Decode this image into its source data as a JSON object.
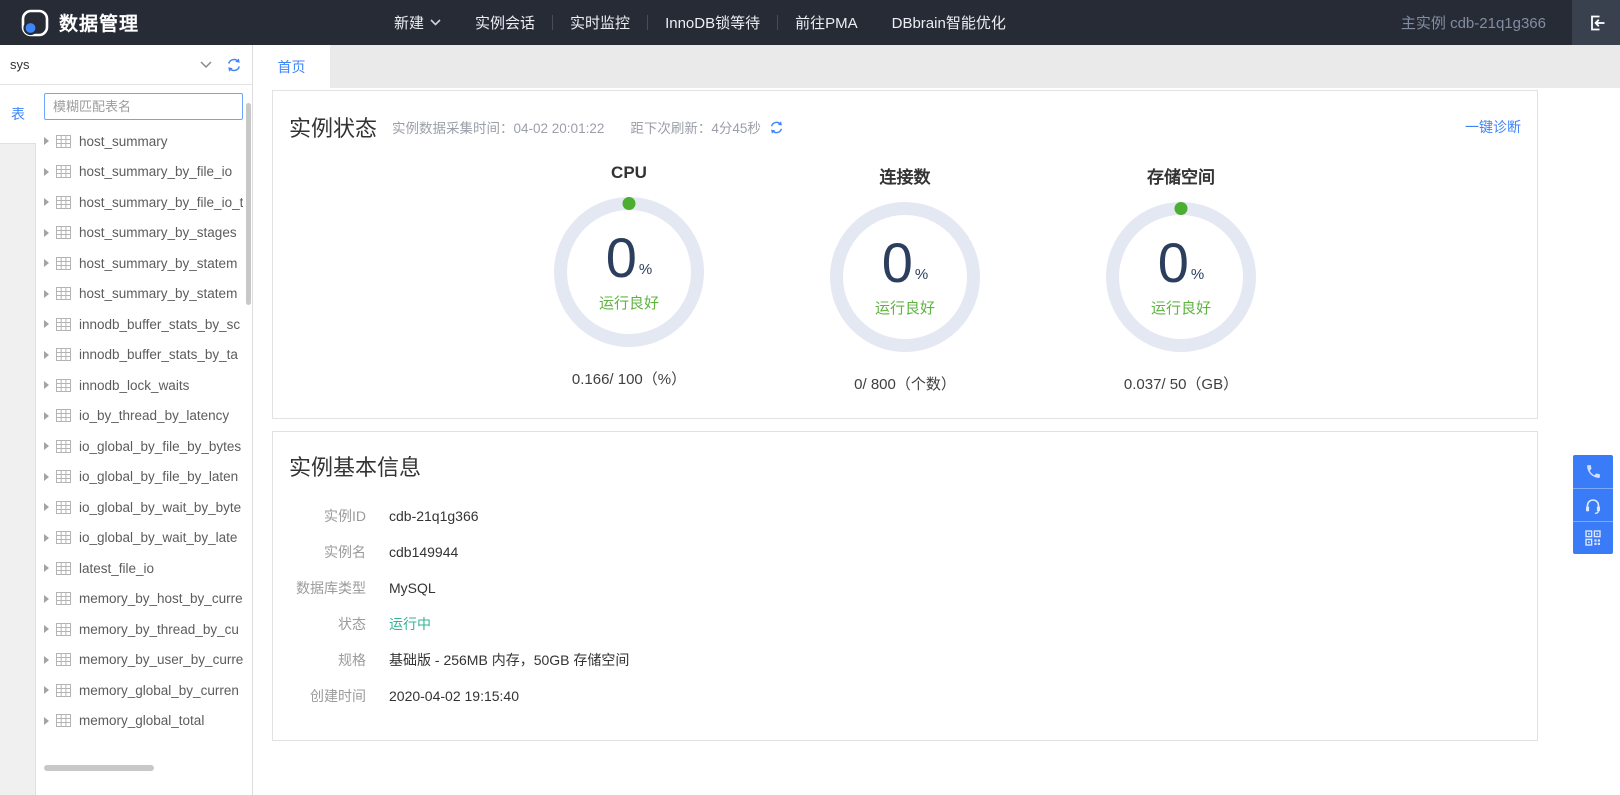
{
  "nav": {
    "brand": "数据管理",
    "menu": [
      {
        "label": "新建",
        "has_dropdown": true
      },
      {
        "label": "实例会话"
      },
      {
        "label": "实时监控",
        "sep_before": true
      },
      {
        "label": "InnoDB锁等待",
        "sep_before": true
      },
      {
        "label": "前往PMA",
        "sep_before": true
      },
      {
        "label": "DBbrain智能优化"
      }
    ],
    "instance_label": "主实例 cdb-21q1g366"
  },
  "sidebar": {
    "database_select": "sys",
    "tables_tab": "表",
    "search_placeholder": "模糊匹配表名",
    "tables": [
      "host_summary",
      "host_summary_by_file_io",
      "host_summary_by_file_io_t",
      "host_summary_by_stages",
      "host_summary_by_statem",
      "host_summary_by_statem",
      "innodb_buffer_stats_by_sc",
      "innodb_buffer_stats_by_ta",
      "innodb_lock_waits",
      "io_by_thread_by_latency",
      "io_global_by_file_by_bytes",
      "io_global_by_file_by_laten",
      "io_global_by_wait_by_byte",
      "io_global_by_wait_by_late",
      "latest_file_io",
      "memory_by_host_by_curre",
      "memory_by_thread_by_cu",
      "memory_by_user_by_curre",
      "memory_global_by_curren",
      "memory_global_total"
    ]
  },
  "tabs": {
    "active": "首页"
  },
  "status_panel": {
    "title": "实例状态",
    "collect_time": "实例数据采集时间：04-02 20:01:22",
    "refresh_countdown": "距下次刷新：4分45秒",
    "diagnose_link": "一键诊断",
    "gauges": [
      {
        "title": "CPU",
        "percent": "0",
        "unit": "%",
        "status": "运行良好",
        "usage": "0.166/ 100（%）",
        "has_dot": true
      },
      {
        "title": "连接数",
        "percent": "0",
        "unit": "%",
        "status": "运行良好",
        "usage": "0/ 800（个数）",
        "has_dot": false
      },
      {
        "title": "存储空间",
        "percent": "0",
        "unit": "%",
        "status": "运行良好",
        "usage": "0.037/ 50（GB）",
        "has_dot": true
      }
    ]
  },
  "info_panel": {
    "title": "实例基本信息",
    "rows": [
      {
        "label": "实例ID",
        "value": "cdb-21q1g366"
      },
      {
        "label": "实例名",
        "value": "cdb149944"
      },
      {
        "label": "数据库类型",
        "value": "MySQL"
      },
      {
        "label": "状态",
        "value": "运行中"
      },
      {
        "label": "规格",
        "value": "基础版 - 256MB 内存，50GB 存储空间"
      },
      {
        "label": "创建时间",
        "value": "2020-04-02 19:15:40"
      }
    ]
  },
  "colors": {
    "accent_blue": "#3f85fa",
    "nav_bg": "#262b36",
    "status_green": "#5fb440",
    "dot_green": "#4cae31",
    "running_teal": "#36b394",
    "ring_gray": "#e3e8f2"
  }
}
